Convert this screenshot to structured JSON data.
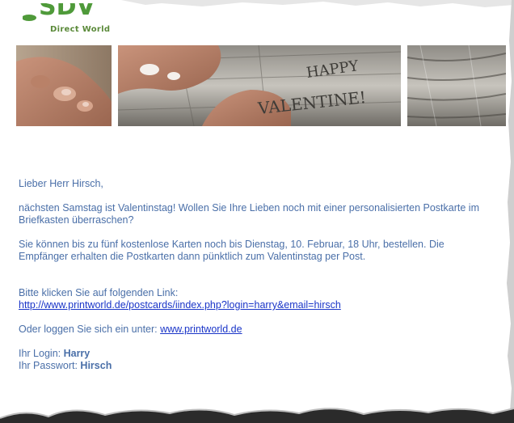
{
  "header": {
    "logo_mark": "SDV",
    "logo_subtitle": "Direct World"
  },
  "banner": {
    "carved_text_line1": "HAPPY",
    "carved_text_line2": "VALENTINE!"
  },
  "email": {
    "greeting": "Lieber Herr Hirsch,",
    "paragraph1": "nächsten Samstag ist Valentinstag! Wollen Sie Ihre Lieben noch mit einer personalisierten Postkarte im Briefkasten überraschen?",
    "paragraph2": "Sie können bis zu fünf kostenlose Karten noch bis Dienstag, 10. Februar, 18 Uhr, bestellen. Die Empfänger erhalten die Postkarten dann pünktlich zum Valentinstag per Post.",
    "click_prompt": "Bitte klicken Sie auf folgenden Link:",
    "link_url": "http://www.printworld.de/postcards/iindex.php?login=harry&email=hirsch",
    "login_prompt": "Oder loggen Sie sich ein unter: ",
    "site_link": "www.printworld.de",
    "login_label": "Ihr Login: ",
    "login_value": "Harry",
    "password_label": "Ihr Passwort: ",
    "password_value": "Hirsch"
  },
  "colors": {
    "body_text": "#4a6fa8",
    "link": "#1a35c8",
    "logo_green": "#5b8a3a"
  }
}
